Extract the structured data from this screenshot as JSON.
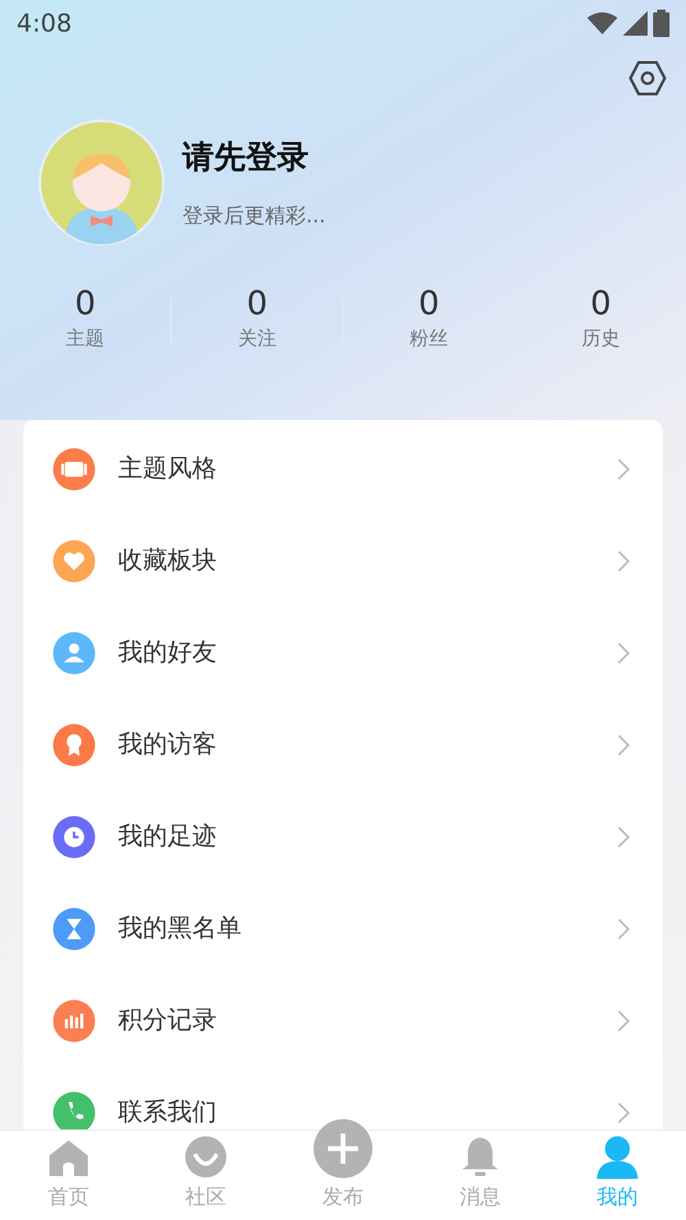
{
  "status_bar": {
    "time": "4:08"
  },
  "profile": {
    "name": "请先登录",
    "subtitle": "登录后更精彩..."
  },
  "stats": [
    {
      "value": "0",
      "label": "主题"
    },
    {
      "value": "0",
      "label": "关注"
    },
    {
      "value": "0",
      "label": "粉丝"
    },
    {
      "value": "0",
      "label": "历史"
    }
  ],
  "menu": [
    {
      "label": "主题风格",
      "kind": "theme",
      "color": "#fb7d4a"
    },
    {
      "label": "收藏板块",
      "kind": "heart",
      "color": "#fda552"
    },
    {
      "label": "我的好友",
      "kind": "user",
      "color": "#5cb8fb"
    },
    {
      "label": "我的访客",
      "kind": "badge",
      "color": "#fb7a47"
    },
    {
      "label": "我的足迹",
      "kind": "clock",
      "color": "#6b6cf5"
    },
    {
      "label": "我的黑名单",
      "kind": "hourglass",
      "color": "#4d9af8"
    },
    {
      "label": "积分记录",
      "kind": "chart",
      "color": "#fb7f52"
    },
    {
      "label": "联系我们",
      "kind": "phone",
      "color": "#45c06a"
    }
  ],
  "tabs": [
    {
      "label": "首页",
      "kind": "home",
      "selected": false
    },
    {
      "label": "社区",
      "kind": "community",
      "selected": false
    },
    {
      "label": "发布",
      "kind": "publish",
      "selected": false
    },
    {
      "label": "消息",
      "kind": "bell",
      "selected": false
    },
    {
      "label": "我的",
      "kind": "person",
      "selected": true
    }
  ]
}
